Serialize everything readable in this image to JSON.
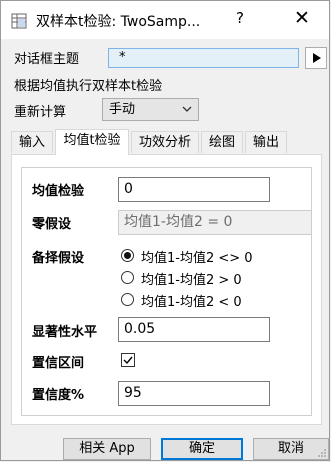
{
  "window": {
    "title": "双样本t检验: TwoSamp...",
    "help_label": "?",
    "close_label": "✕"
  },
  "dialog_theme": {
    "label": "对话框主题",
    "value": "*",
    "arrow_label": "▶"
  },
  "description": "根据均值执行双样本t检验",
  "recalc": {
    "label": "重新计算",
    "value": "手动"
  },
  "tabs": [
    {
      "label": "输入",
      "active": false
    },
    {
      "label": "均值t检验",
      "active": true
    },
    {
      "label": "功效分析",
      "active": false
    },
    {
      "label": "绘图",
      "active": false
    },
    {
      "label": "输出",
      "active": false
    }
  ],
  "form": {
    "mean_test": {
      "label": "均值检验",
      "value": "0"
    },
    "null_hypothesis": {
      "label": "零假设",
      "value": "均值1-均值2 = 0"
    },
    "alt_hypothesis": {
      "label": "备择假设",
      "options": [
        {
          "label": "均值1-均值2 <> 0",
          "checked": true
        },
        {
          "label": "均值1-均值2 > 0",
          "checked": false
        },
        {
          "label": "均值1-均值2 < 0",
          "checked": false
        }
      ]
    },
    "significance": {
      "label": "显著性水平",
      "value": "0.05"
    },
    "conf_interval": {
      "label": "置信区间",
      "checked": true
    },
    "conf_level": {
      "label": "置信度%",
      "value": "95"
    }
  },
  "buttons": {
    "related_app": "相关 App",
    "ok": "确定",
    "cancel": "取消"
  }
}
